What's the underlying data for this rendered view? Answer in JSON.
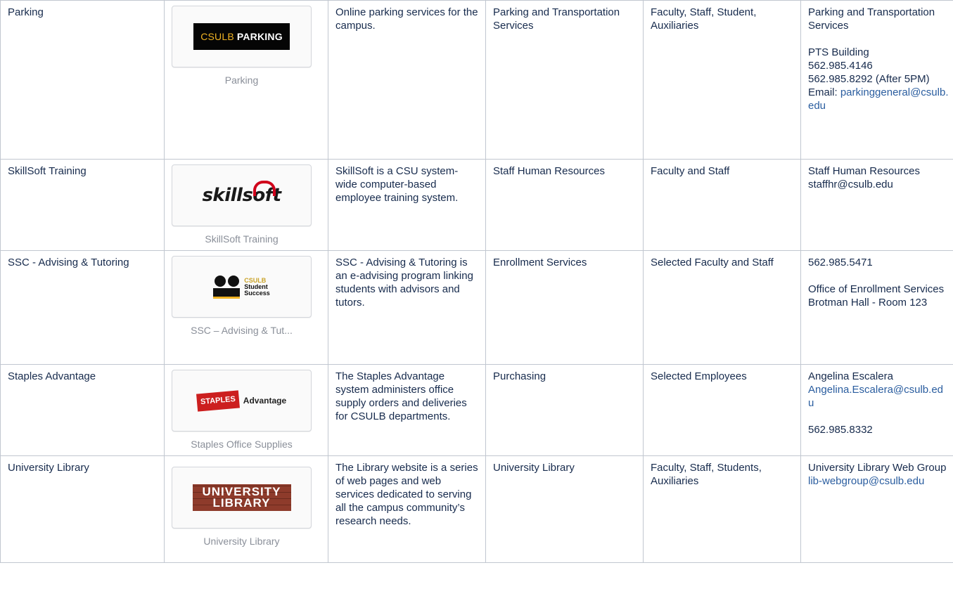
{
  "rows": [
    {
      "name": "Parking",
      "logo_icon": "csulb-parking-logo",
      "logo_text_a": "CSULB",
      "logo_text_b": "PARKING",
      "caption": "Parking",
      "description": "Online parking services for the campus.",
      "department": "Parking and Transportation Services",
      "audience": "Faculty, Staff, Student, Auxiliaries",
      "contact": {
        "line1": "Parking and Transportation Services",
        "line2": "PTS Building",
        "line3": "562.985.4146",
        "line4": "562.985.8292 (After 5PM)",
        "email_label": "Email: ",
        "email": "parkinggeneral@csulb.edu"
      }
    },
    {
      "name": "SkillSoft Training",
      "logo_icon": "skillsoft-logo",
      "logo_text": "skillsoft",
      "caption": "SkillSoft Training",
      "description": "SkillSoft is a CSU system-wide computer-based employee training system.",
      "department": "Staff Human Resources",
      "audience": "Faculty and Staff",
      "contact": {
        "line1": "Staff Human Resources",
        "line2": "staffhr@csulb.edu"
      }
    },
    {
      "name": "SSC - Advising & Tutoring",
      "logo_icon": "csulb-student-success-logo",
      "logo_text_a": "CSULB",
      "logo_text_b": "Student",
      "logo_text_c": "Success",
      "caption": "SSC – Advising & Tut...",
      "description": "SSC - Advising & Tutoring is an e-advising program linking students with advisors and tutors.",
      "department": "Enrollment Services",
      "audience": "Selected Faculty and Staff",
      "contact": {
        "line1": "562.985.5471",
        "line2": "Office of Enrollment Services",
        "line3": "Brotman Hall - Room 123"
      }
    },
    {
      "name": "Staples Advantage",
      "logo_icon": "staples-advantage-logo",
      "logo_text_a": "STAPLES",
      "logo_text_b": "Advantage",
      "caption": "Staples Office Supplies",
      "description": "The Staples Advantage system administers office supply orders and deliveries for CSULB departments.",
      "department": "Purchasing",
      "audience": "Selected Employees",
      "contact": {
        "line1": "Angelina Escalera",
        "email": "Angelina.Escalera@csulb.edu",
        "line2": "562.985.8332"
      }
    },
    {
      "name": "University Library",
      "logo_icon": "university-library-logo",
      "logo_text_a": "UNIVERSITY",
      "logo_text_b": "LIBRARY",
      "caption": "University Library",
      "description": "The Library website is a series of web pages and web services dedicated to serving all the campus community’s research needs.",
      "department": "University Library",
      "audience": "Faculty, Staff, Students, Auxiliaries",
      "contact": {
        "line1": "University Library Web Group",
        "email": "lib-webgroup@csulb.edu"
      }
    }
  ],
  "colors": {
    "link": "#2a5d9f",
    "border": "#c1c7d0",
    "caption": "#8a8f99",
    "parking_gold": "#f0b323",
    "skillsoft_red": "#d0021b",
    "staples_red": "#cc1f1f",
    "library_brick": "#8e3b2b"
  }
}
